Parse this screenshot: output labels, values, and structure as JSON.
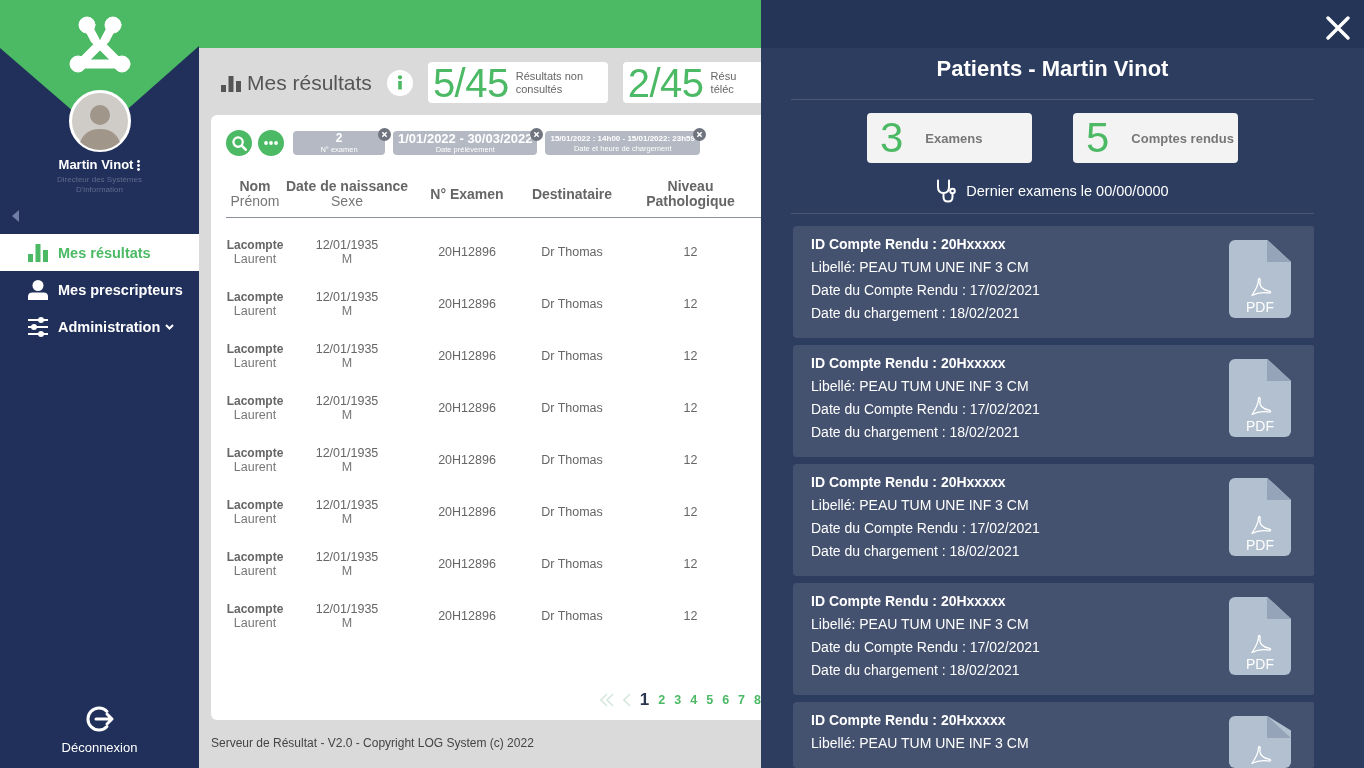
{
  "sidebar": {
    "user": {
      "name": "Martin Vinot",
      "role": "Directeur des Systèmes D'information"
    },
    "nav": [
      {
        "label": "Mes résultats",
        "selected": true,
        "submenu": false
      },
      {
        "label": "Mes prescripteurs",
        "selected": false,
        "submenu": false
      },
      {
        "label": "Administration",
        "selected": false,
        "submenu": true
      }
    ],
    "logout": {
      "label": "Déconnexion"
    }
  },
  "header": {
    "title": "Mes résultats",
    "stats": [
      {
        "value": "5/45",
        "label": "Résultats non consultés"
      },
      {
        "value": "2/45",
        "label": "Résu téléc"
      }
    ]
  },
  "filters": [
    {
      "value": "2",
      "label": "N° examen"
    },
    {
      "value": "1/01/2022 - 30/03/2022",
      "label": "Date prélèvement"
    },
    {
      "value": "15/01/2022 : 14h00 - 15/01/2022: 23h59",
      "label": "Date et heure de chargement"
    }
  ],
  "table": {
    "columns": [
      {
        "title": "Nom",
        "subtitle": "Prénom"
      },
      {
        "title": "Date de naissance",
        "subtitle": "Sexe"
      },
      {
        "title": "N° Examen"
      },
      {
        "title": "Destinataire"
      },
      {
        "title": "Niveau Pathologique"
      }
    ],
    "rows": [
      {
        "cells": [
          [
            "Lacompte",
            "Laurent"
          ],
          [
            "12/01/1935",
            "M"
          ],
          [
            "20H12896"
          ],
          [
            "Dr Thomas"
          ],
          [
            "12"
          ]
        ]
      },
      {
        "cells": [
          [
            "Lacompte",
            "Laurent"
          ],
          [
            "12/01/1935",
            "M"
          ],
          [
            "20H12896"
          ],
          [
            "Dr Thomas"
          ],
          [
            "12"
          ]
        ]
      },
      {
        "cells": [
          [
            "Lacompte",
            "Laurent"
          ],
          [
            "12/01/1935",
            "M"
          ],
          [
            "20H12896"
          ],
          [
            "Dr Thomas"
          ],
          [
            "12"
          ]
        ]
      },
      {
        "cells": [
          [
            "Lacompte",
            "Laurent"
          ],
          [
            "12/01/1935",
            "M"
          ],
          [
            "20H12896"
          ],
          [
            "Dr Thomas"
          ],
          [
            "12"
          ]
        ]
      },
      {
        "cells": [
          [
            "Lacompte",
            "Laurent"
          ],
          [
            "12/01/1935",
            "M"
          ],
          [
            "20H12896"
          ],
          [
            "Dr Thomas"
          ],
          [
            "12"
          ]
        ]
      },
      {
        "cells": [
          [
            "Lacompte",
            "Laurent"
          ],
          [
            "12/01/1935",
            "M"
          ],
          [
            "20H12896"
          ],
          [
            "Dr Thomas"
          ],
          [
            "12"
          ]
        ]
      },
      {
        "cells": [
          [
            "Lacompte",
            "Laurent"
          ],
          [
            "12/01/1935",
            "M"
          ],
          [
            "20H12896"
          ],
          [
            "Dr Thomas"
          ],
          [
            "12"
          ]
        ]
      },
      {
        "cells": [
          [
            "Lacompte",
            "Laurent"
          ],
          [
            "12/01/1935",
            "M"
          ],
          [
            "20H12896"
          ],
          [
            "Dr Thomas"
          ],
          [
            "12"
          ]
        ]
      }
    ]
  },
  "pagination": {
    "back_disabled": true,
    "pages": [
      {
        "label": "1",
        "selected": true
      },
      {
        "label": "2",
        "selected": false
      },
      {
        "label": "3",
        "selected": false
      },
      {
        "label": "4",
        "selected": false
      },
      {
        "label": "5",
        "selected": false
      },
      {
        "label": "6",
        "selected": false
      },
      {
        "label": "7",
        "selected": false
      },
      {
        "label": "8",
        "selected": false
      }
    ]
  },
  "footer": "Serveur de Résultat - V2.0 - Copyright LOG System (c) 2022",
  "panel": {
    "title": "Patients - Martin Vinot",
    "stats": [
      {
        "value": "3",
        "label": "Examens"
      },
      {
        "value": "5",
        "label": "Comptes rendus"
      }
    ],
    "last_exam": "Dernier examens le 00/00/0000",
    "reports": [
      {
        "title": "ID Compte Rendu : 20Hxxxxx",
        "lines": [
          "Libellé: PEAU TUM UNE INF 3 CM",
          "Date du Compte Rendu : 17/02/2021",
          "Date du chargement : 18/02/2021"
        ],
        "file_label": "PDF"
      },
      {
        "title": "ID Compte Rendu : 20Hxxxxx",
        "lines": [
          "Libellé: PEAU TUM UNE INF 3 CM",
          "Date du Compte Rendu : 17/02/2021",
          "Date du chargement : 18/02/2021"
        ],
        "file_label": "PDF"
      },
      {
        "title": "ID Compte Rendu : 20Hxxxxx",
        "lines": [
          "Libellé: PEAU TUM UNE INF 3 CM",
          "Date du Compte Rendu : 17/02/2021",
          "Date du chargement : 18/02/2021"
        ],
        "file_label": "PDF"
      },
      {
        "title": "ID Compte Rendu : 20Hxxxxx",
        "lines": [
          "Libellé: PEAU TUM UNE INF 3 CM",
          "Date du Compte Rendu : 17/02/2021",
          "Date du chargement : 18/02/2021"
        ],
        "file_label": "PDF"
      },
      {
        "title": "ID Compte Rendu : 20Hxxxxx",
        "lines": [
          "Libellé: PEAU TUM UNE INF 3 CM"
        ]
      }
    ]
  }
}
